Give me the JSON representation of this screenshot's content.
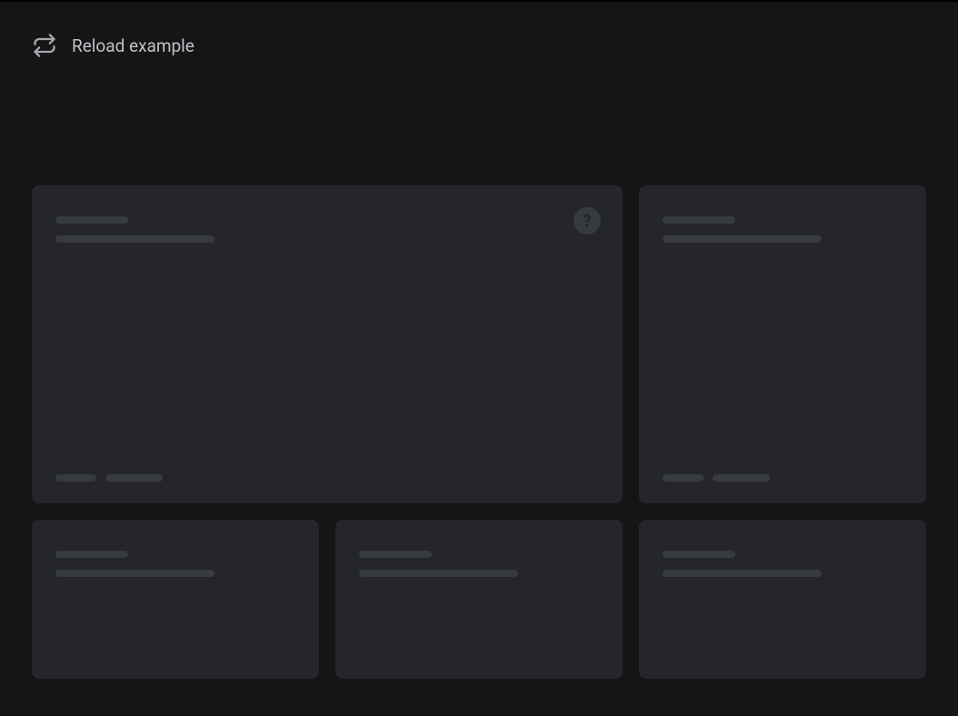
{
  "header": {
    "reload_label": "Reload example"
  },
  "icons": {
    "reload": "reload-icon",
    "help": "help-icon",
    "help_glyph": "?"
  },
  "cards": [
    {
      "layout": "wide",
      "has_help": true,
      "has_footer": true
    },
    {
      "layout": "narrow",
      "has_help": false,
      "has_footer": true
    },
    {
      "layout": "narrow",
      "has_help": false,
      "has_footer": false
    },
    {
      "layout": "narrow",
      "has_help": false,
      "has_footer": false
    },
    {
      "layout": "narrow",
      "has_help": false,
      "has_footer": false
    }
  ],
  "colors": {
    "background": "#141517",
    "card": "#25262b",
    "skeleton": "#373a40",
    "text": "#c1c2c5"
  }
}
